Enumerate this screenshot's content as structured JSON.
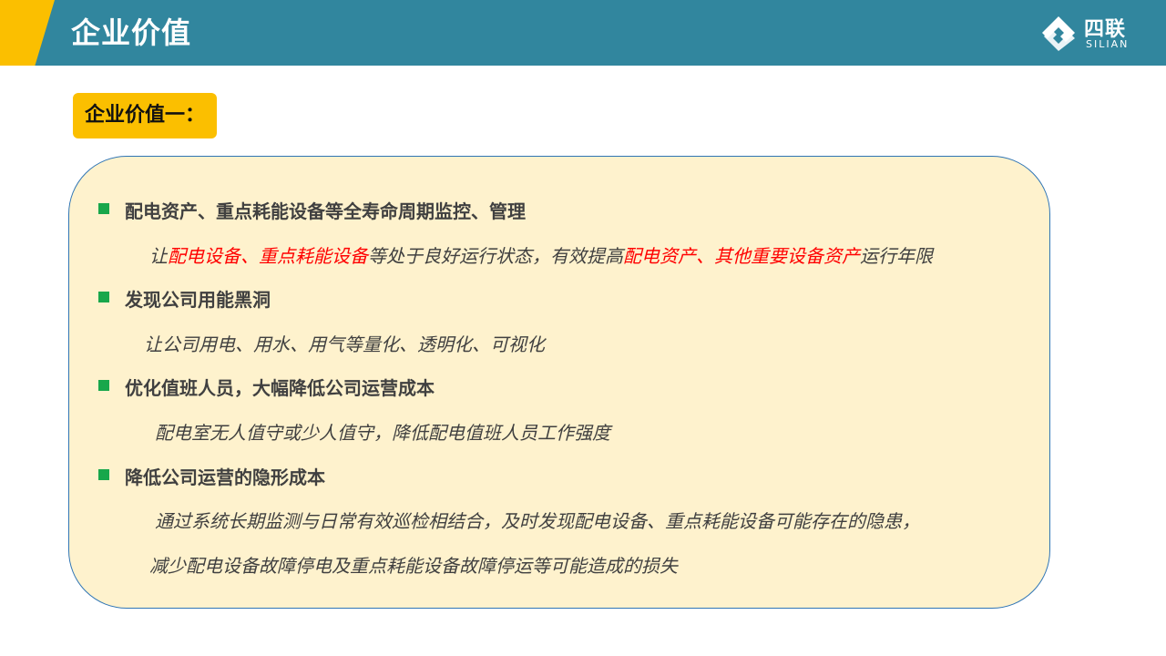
{
  "header": {
    "title": "企业价值",
    "logo_text": "四联",
    "logo_subtext": "SILIAN"
  },
  "tag_label": "企业价值一：",
  "items": [
    {
      "heading": "配电资产、重点耗能设备等全寿命周期监控、管理",
      "desc_parts": [
        "让",
        "配电设备、重点耗能设备",
        "等处于良好运行状态，有效提高",
        "配电资产、其他重要设备资产",
        "运行年限"
      ]
    },
    {
      "heading": "发现公司用能黑洞",
      "desc": "让公司用电、用水、用气等量化、透明化、可视化"
    },
    {
      "heading": "优化值班人员，大幅降低公司运营成本",
      "desc": "配电室无人值守或少人值守，降低配电值班人员工作强度"
    },
    {
      "heading": "降低公司运营的隐形成本",
      "desc_lines": [
        "通过系统长期监测与日常有效巡检相结合，及时发现配电设备、重点耗能设备可能存在的隐患，",
        "减少配电设备故障停电及重点耗能设备故障停运等可能造成的损失"
      ]
    }
  ],
  "colors": {
    "header": "#31869e",
    "accent": "#fbbf00",
    "panel": "#fef2cd",
    "panel_border": "#2f75b5",
    "bullet": "#18a74b",
    "highlight": "#ff0000"
  }
}
